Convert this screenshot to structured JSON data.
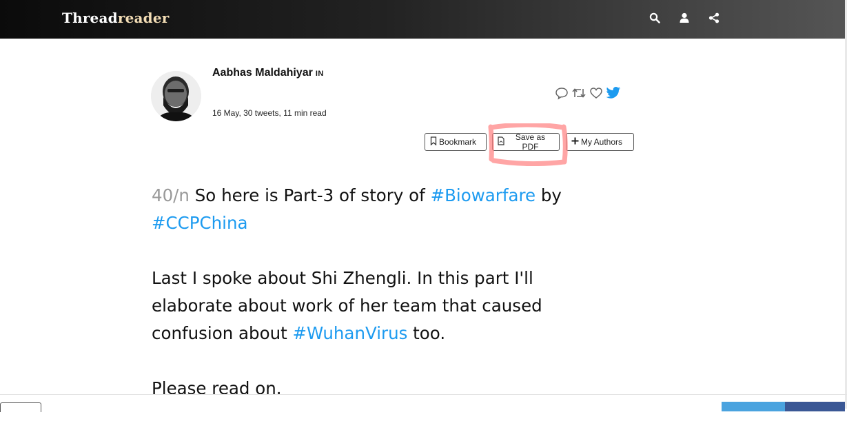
{
  "header": {
    "brand_part1": "Thread",
    "brand_part2": "reader",
    "icons": [
      "search-icon",
      "user-icon",
      "share-icon"
    ]
  },
  "author": {
    "name": "Aabhas Maldahiyar",
    "country_code": "IN",
    "meta": "16 May, 30 tweets, 11 min read"
  },
  "actions": {
    "bookmark_label": "Bookmark",
    "pdf_label": "Save as PDF",
    "authors_label": "My Authors"
  },
  "social_icons": [
    "reply-icon",
    "retweet-icon",
    "like-icon",
    "twitter-icon"
  ],
  "tweet": {
    "number": "40/n",
    "p1_text1": " So here is Part-3 of story of ",
    "p1_tag1": "#Biowarfare",
    "p1_text2": " by ",
    "p1_tag2": "#CCPChina",
    "p2_text1": "Last I spoke about Shi Zhengli. In this part I'll elaborate about work of her team that caused confusion about ",
    "p2_tag1": "#WuhanVirus",
    "p2_text2": " too.",
    "p3_text": "Please read on."
  },
  "colors": {
    "accent": "#1d9bf0",
    "highlight": "#ff8a8a",
    "topbar": "#1a1a1a"
  }
}
